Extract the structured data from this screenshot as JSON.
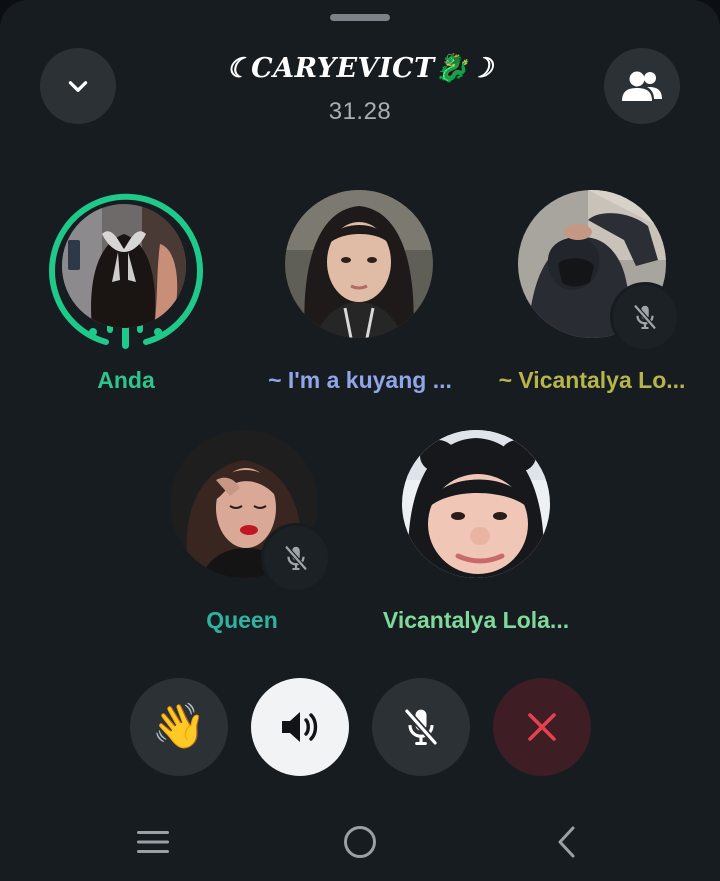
{
  "header": {
    "title": "☾CARYEVICT🐉☽",
    "timer": "31.28"
  },
  "participants": [
    {
      "name": "Anda",
      "name_color": "#2fc48d",
      "speaking": true,
      "muted": false
    },
    {
      "name": "~ I'm a kuyang ...",
      "name_color": "#8fa6e8",
      "speaking": false,
      "muted": false
    },
    {
      "name": "~ Vicantalya Lo...",
      "name_color": "#b7b54a",
      "speaking": false,
      "muted": true
    },
    {
      "name": "Queen",
      "name_color": "#2fb3a0",
      "speaking": false,
      "muted": true
    },
    {
      "name": "Vicantalya Lola...",
      "name_color": "#7fd99a",
      "speaking": false,
      "muted": false
    }
  ],
  "controls": {
    "wave_emoji": "👋",
    "speaker_active": true,
    "mic_muted": true
  },
  "colors": {
    "background": "#171c21",
    "speaking_ring": "#1ec98a",
    "leave_button": "#3e1d24",
    "leave_icon": "#e5414f"
  },
  "icons": [
    "chevron-down-icon",
    "group-icon",
    "mic-off-icon",
    "speaker-icon",
    "close-icon",
    "menu-icon",
    "home-icon",
    "back-icon"
  ]
}
